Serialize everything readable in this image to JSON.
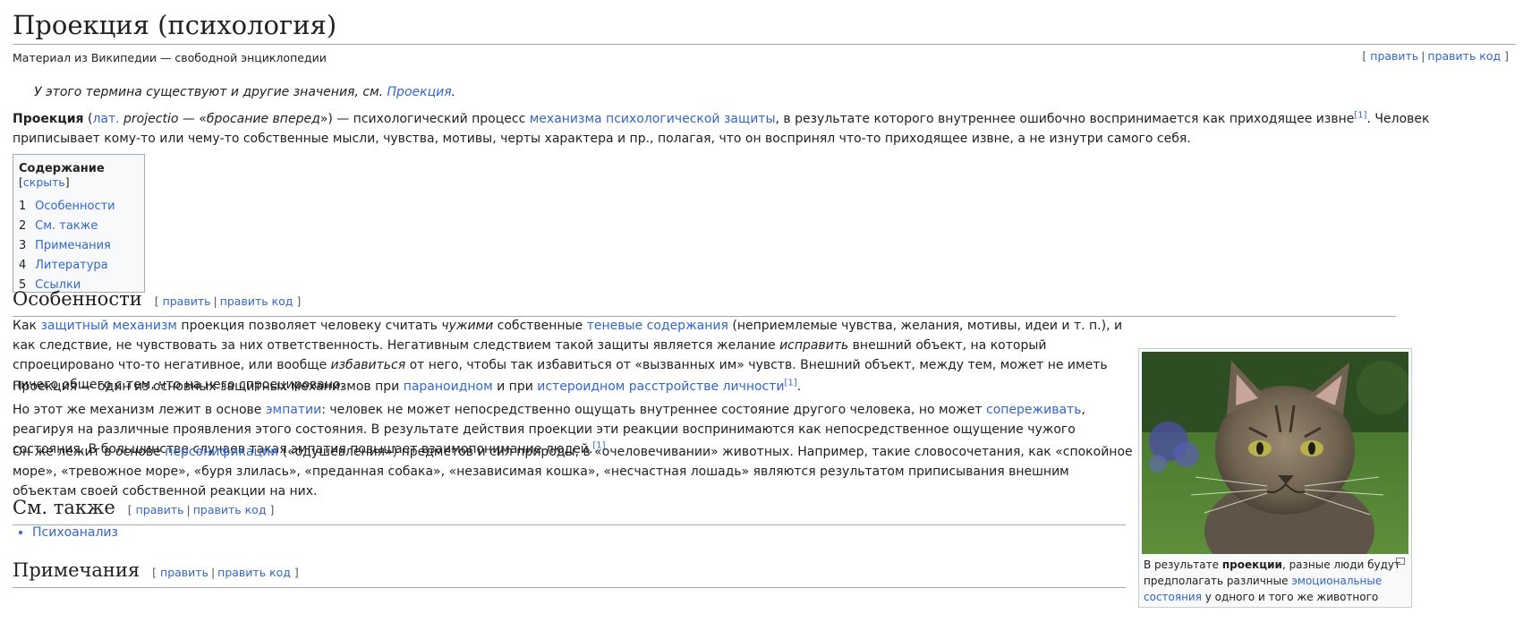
{
  "article": {
    "title": "Проекция (психология)",
    "tagline": "Материал из Википедии — свободной энциклопедии",
    "edit": "править",
    "edit_source": "править код",
    "hatnote": {
      "prefix": "У этого термина существуют и другие значения, см. ",
      "link": "Проекция",
      "suffix": "."
    }
  },
  "lead": {
    "term": "Проекция",
    "p1": " (",
    "lat": "лат.",
    "lat_word": " projectio",
    "p2": " — «",
    "translation": "бросание вперед",
    "p3": "») — психологический процесс ",
    "link_mechanism": "механизма психологической защиты",
    "p4": ", в результате которого внутреннее ошибочно воспринимается как приходящее извне",
    "ref": "[1]",
    "p5": ". Человек приписывает кому-то или чему-то собственные мысли, чувства, мотивы, черты характера и пр., полагая, что он воспринял что-то приходящее извне, а не изнутри самого себя."
  },
  "toc": {
    "title": "Содержание",
    "toggle": "скрыть",
    "items": [
      {
        "num": "1",
        "label": "Особенности"
      },
      {
        "num": "2",
        "label": "См. также"
      },
      {
        "num": "3",
        "label": "Примечания"
      },
      {
        "num": "4",
        "label": "Литература"
      },
      {
        "num": "5",
        "label": "Ссылки"
      }
    ]
  },
  "sections": {
    "features": {
      "heading": "Особенности",
      "para1": {
        "a": "Как ",
        "link1": "защитный механизм",
        "b": " проекция позволяет человеку считать ",
        "i1": "чужими",
        "c": " собственные ",
        "link2": "теневые содержания",
        "d": " (неприемлемые чувства, желания, мотивы, идеи и т. п.), и как следствие, не чувствовать за них ответственность. Негативным следствием такой защиты является желание ",
        "i2": "исправить",
        "e": " внешний объект, на который спроецировано что-то негативное, или вообще ",
        "i3": "избавиться",
        "f": " от него, чтобы так избавиться от «вызванных им» чувств. Внешний объект, между тем, может не иметь ничего общего с тем, что на него спроецировано."
      },
      "para2": {
        "a": "Проекция — один из основных защитных механизмов при ",
        "link1": "параноидном",
        "b": " и при ",
        "link2": "истероидном расстройстве личности",
        "ref": "[1]",
        "c": "."
      },
      "para3": {
        "a": "Но этот же механизм лежит в основе ",
        "link1": "эмпатии",
        "b": ": человек не может непосредственно ощущать внутреннее состояние другого человека, но может ",
        "link2": "сопереживать",
        "c": ", реагируя на различные проявления этого состояния. В результате действия проекции эти реакции воспринимаются как непосредственное ощущение чужого состояния. В большинстве случаев такая эмпатия повышает взаимопонимание людей.",
        "ref": "[1]"
      },
      "para4": {
        "a": "Он же лежит в основе ",
        "link1": "персонификации",
        "b": " («одушевления») предметов и сил природы, в «очеловечивании» животных. Например, такие словосочетания, как «спокойное море», «тревожное море», «буря злилась», «преданная собака», «независимая кошка», «несчастная лошадь» являются результатом приписывания внешним объектам своей собственной реакции на них."
      }
    },
    "see_also": {
      "heading": "См. также",
      "items": [
        "Психоанализ"
      ]
    },
    "notes": {
      "heading": "Примечания"
    }
  },
  "figure": {
    "icon": "cat-photo",
    "caption_a": "В результате ",
    "caption_bold": "проекции",
    "caption_b": ", разные люди будут предполагать различные ",
    "caption_link": "эмоциональные состояния",
    "caption_c": " у одного и того же животного"
  },
  "colors": {
    "link": "#3366cc",
    "text": "#202122",
    "border": "#a2a9b1",
    "toc_bg": "#f8f9fa"
  }
}
